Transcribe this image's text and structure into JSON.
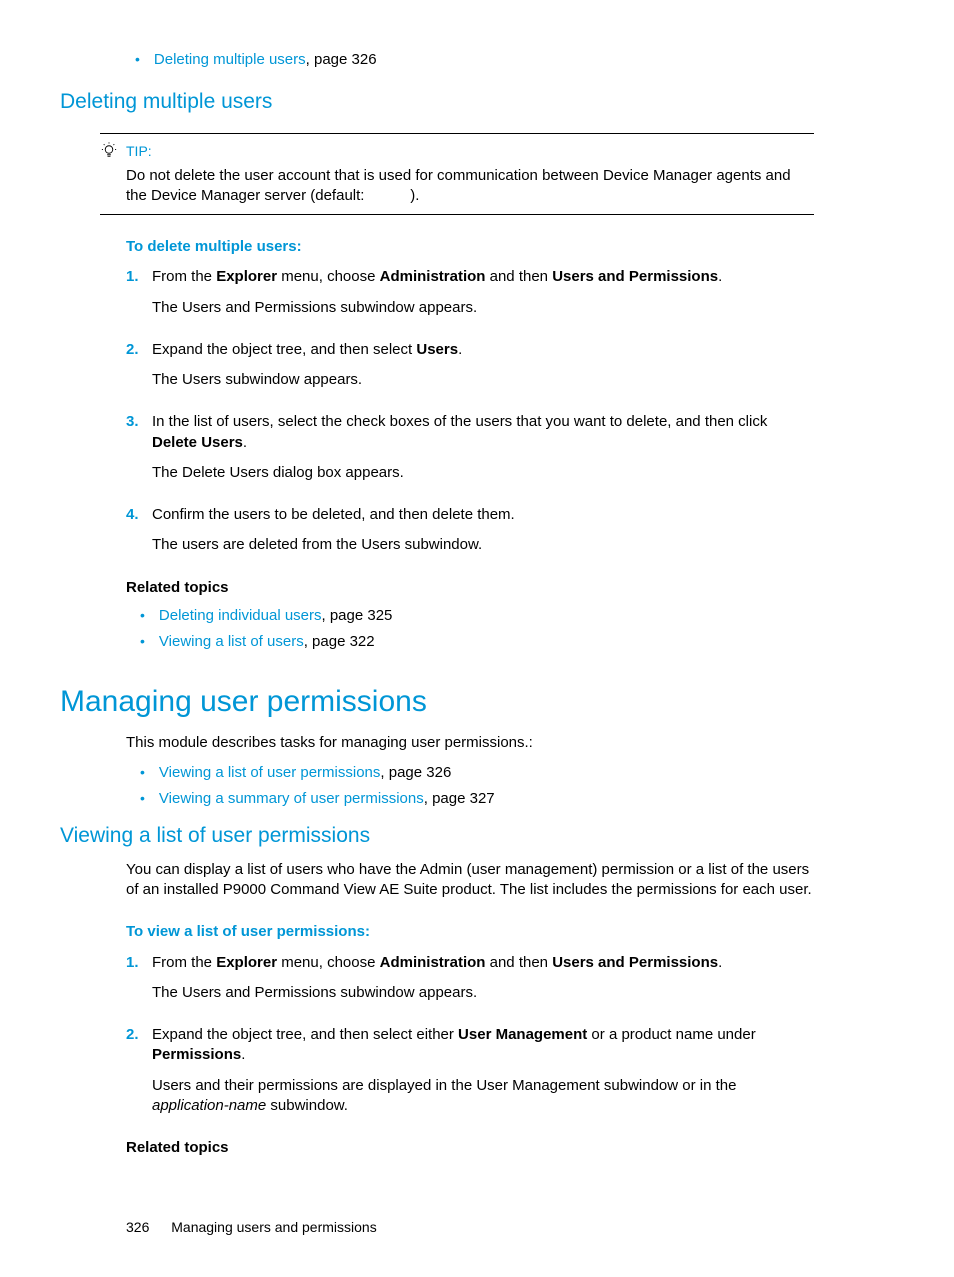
{
  "topBullet": {
    "link": "Deleting multiple users",
    "suffix": ", page 326"
  },
  "sec1": {
    "title": "Deleting multiple users",
    "tipLabel": "TIP:",
    "tipBody": "Do not delete the user account that is used for communication between Device Manager agents and the Device Manager server (default:           ).",
    "stepsHead": "To delete multiple users:",
    "steps": [
      {
        "n": "1.",
        "a": "From the ",
        "b1": "Explorer",
        "c": " menu, choose ",
        "b2": "Administration",
        "d": " and then ",
        "b3": "Users and Permissions",
        "e": ".",
        "after": "The Users and Permissions subwindow appears."
      },
      {
        "n": "2.",
        "a": "Expand the object tree, and then select ",
        "b1": "Users",
        "e": ".",
        "after": "The Users subwindow appears."
      },
      {
        "n": "3.",
        "a": "In the list of users, select the check boxes of the users that you want to delete, and then click ",
        "b1": "Delete Users",
        "e": ".",
        "after": "The Delete Users dialog box appears."
      },
      {
        "n": "4.",
        "a": "Confirm the users to be deleted, and then delete them.",
        "after": "The users are deleted from the Users subwindow."
      }
    ],
    "relatedHead": "Related topics",
    "related": [
      {
        "link": "Deleting individual users",
        "suffix": ", page 325"
      },
      {
        "link": "Viewing a list of users",
        "suffix": ", page 322"
      }
    ]
  },
  "sec2": {
    "title": "Managing user permissions",
    "intro": "This module describes tasks for managing user permissions.:",
    "bullets": [
      {
        "link": "Viewing a list of user permissions",
        "suffix": ", page 326"
      },
      {
        "link": "Viewing a summary of user permissions",
        "suffix": ", page 327"
      }
    ]
  },
  "sec3": {
    "title": "Viewing a list of user permissions",
    "intro": "You can display a list of users who have the Admin (user management) permission or a list of the users of an installed P9000 Command View AE Suite product. The list includes the permissions for each user.",
    "stepsHead": "To view a list of user permissions:",
    "steps": [
      {
        "n": "1.",
        "a": "From the ",
        "b1": "Explorer",
        "c": " menu, choose ",
        "b2": "Administration",
        "d": " and then ",
        "b3": "Users and Permissions",
        "e": ".",
        "after": "The Users and Permissions subwindow appears."
      },
      {
        "n": "2.",
        "a": "Expand the object tree, and then select either ",
        "b1": "User Management",
        "c": " or a product name under ",
        "b2": "Permissions",
        "e": ".",
        "afterPre": "Users and their permissions are displayed in the User Management subwindow or in the ",
        "afterItalic": "application-name",
        "afterPost": " subwindow."
      }
    ],
    "relatedHead": "Related topics"
  },
  "footer": {
    "page": "326",
    "chapter": "Managing users and permissions"
  }
}
